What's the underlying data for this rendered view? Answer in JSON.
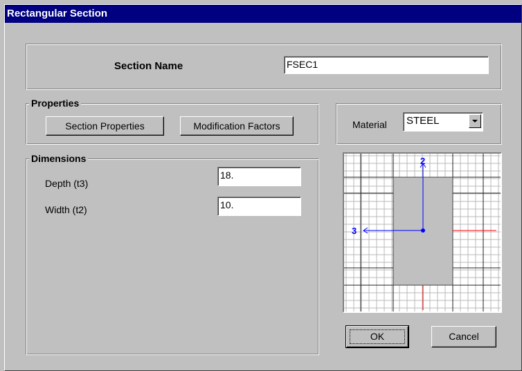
{
  "window": {
    "title": "Rectangular Section"
  },
  "section_name": {
    "label": "Section Name",
    "value": "FSEC1"
  },
  "properties": {
    "legend": "Properties",
    "section_properties_label": "Section Properties",
    "modification_factors_label": "Modification Factors"
  },
  "material": {
    "label": "Material",
    "selected": "STEEL"
  },
  "dimensions": {
    "legend": "Dimensions",
    "depth_label": "Depth (t3)",
    "depth_value": "18.",
    "width_label": "Width (t2)",
    "width_value": "10."
  },
  "preview": {
    "axis_2_label": "2",
    "axis_3_label": "3"
  },
  "buttons": {
    "ok_label": "OK",
    "cancel_label": "Cancel"
  },
  "colors": {
    "title_bar": "#000080",
    "axis_blue": "#0000ff",
    "axis_red": "#ff0000"
  }
}
